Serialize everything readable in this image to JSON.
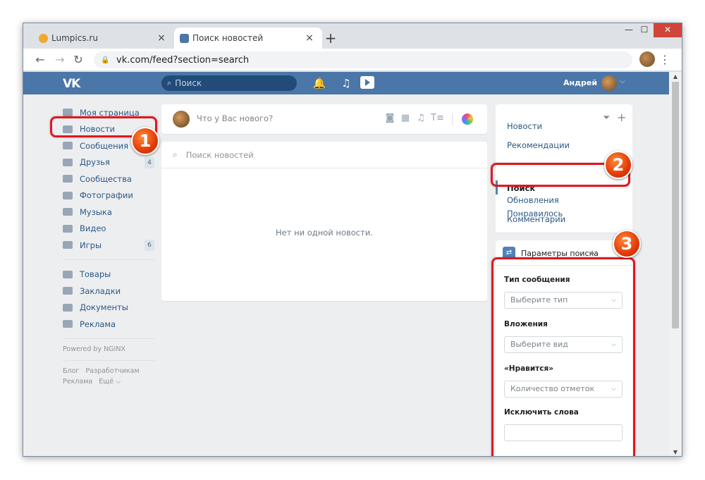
{
  "browser": {
    "tabs": [
      {
        "title": "Lumpics.ru",
        "close": "×",
        "favicon_color": "#f0a830"
      },
      {
        "title": "Поиск новостей",
        "close": "×",
        "favicon_color": "#4a76a8"
      }
    ],
    "new_tab": "+",
    "window_controls": {
      "minimize": "—",
      "maximize": "☐",
      "close": "✕"
    },
    "nav": {
      "back": "←",
      "forward": "→",
      "reload": "↻"
    },
    "url": "vk.com/feed?section=search",
    "bookmark_icon": "☆",
    "menu_icon": "⋮"
  },
  "vk_header": {
    "logo": "VK",
    "search_placeholder": "Поиск",
    "user_name": "Андрей",
    "brand_color": "#4a76a8"
  },
  "left_nav": {
    "items": [
      {
        "label": "Моя страница",
        "icon": "home-icon"
      },
      {
        "label": "Новости",
        "icon": "news-icon"
      },
      {
        "label": "Сообщения",
        "icon": "messages-icon"
      },
      {
        "label": "Друзья",
        "icon": "friends-icon",
        "count": "4"
      },
      {
        "label": "Сообщества",
        "icon": "groups-icon"
      },
      {
        "label": "Фотографии",
        "icon": "camera-icon"
      },
      {
        "label": "Музыка",
        "icon": "music-icon"
      },
      {
        "label": "Видео",
        "icon": "video-icon"
      },
      {
        "label": "Игры",
        "icon": "gamepad-icon",
        "count": "6"
      }
    ],
    "items2": [
      {
        "label": "Товары",
        "icon": "bag-icon"
      },
      {
        "label": "Закладки",
        "icon": "star-icon"
      },
      {
        "label": "Документы",
        "icon": "document-icon"
      },
      {
        "label": "Реклама",
        "icon": "megaphone-icon"
      }
    ],
    "powered": "Powered by NGINX",
    "footer": {
      "blog": "Блог",
      "developers": "Разработчикам",
      "ads": "Реклама",
      "more": "Ещё ⌵"
    }
  },
  "composer": {
    "placeholder": "Что у Вас нового?"
  },
  "news": {
    "search_placeholder": "Поиск новостей",
    "empty_text": "Нет ни одной новости."
  },
  "right_menu": {
    "items": [
      "Новости",
      "Рекомендации",
      "Поиск",
      "Понравилось",
      "Обновления",
      "Комментарии"
    ]
  },
  "search_params": {
    "title": "Параметры поиска",
    "message_type_label": "Тип сообщения",
    "message_type_value": "Выберите тип",
    "attachments_label": "Вложения",
    "attachments_value": "Выберите вид",
    "likes_label": "«Нравится»",
    "likes_value": "Количество отметок",
    "exclude_label": "Исключить слова"
  },
  "annotations": {
    "badges": [
      "1",
      "2",
      "3"
    ],
    "callout_color": "#e0181d"
  }
}
